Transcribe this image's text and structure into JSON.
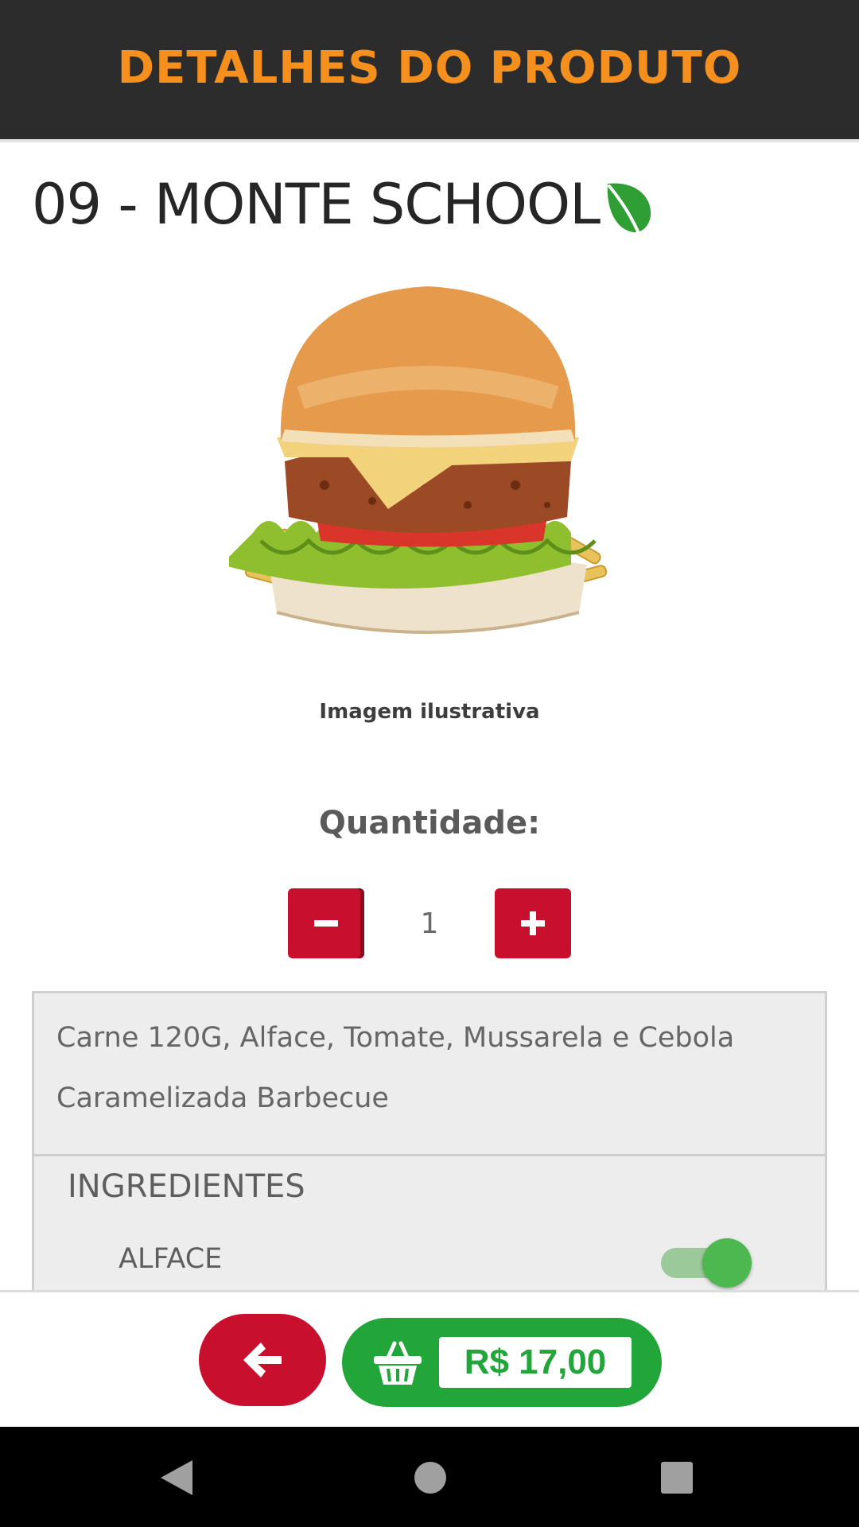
{
  "header": {
    "title": "DETALHES DO PRODUTO"
  },
  "product": {
    "name": "09 - MONTE SCHOOL",
    "image_caption": "Imagem ilustrativa",
    "description": "Carne 120G, Alface, Tomate, Mussarela e Cebola Caramelizada Barbecue"
  },
  "quantity": {
    "label": "Quantidade:",
    "value": "1"
  },
  "ingredients": {
    "title": "INGREDIENTES",
    "items": [
      {
        "name": "ALFACE",
        "enabled": true
      }
    ]
  },
  "cart": {
    "price": "R$ 17,00"
  },
  "colors": {
    "header_bg": "#2c2c2c",
    "header_text": "#f5901e",
    "accent_red": "#c8102e",
    "accent_green": "#22a539",
    "leaf_green": "#2e9e35"
  },
  "icons": {
    "vegetarian": "leaf-icon",
    "decrease": "minus-icon",
    "increase": "plus-icon",
    "back": "arrow-left-icon",
    "cart": "basket-icon",
    "system_back": "triangle-back-icon",
    "system_home": "circle-home-icon",
    "system_recents": "square-recents-icon"
  }
}
